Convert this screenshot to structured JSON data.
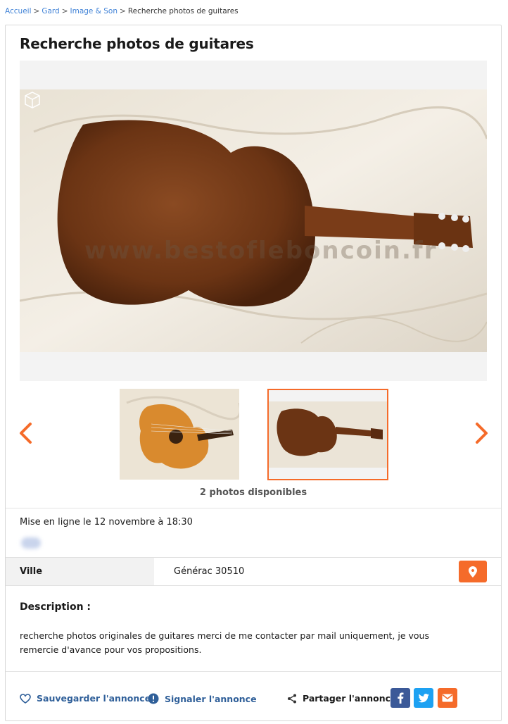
{
  "breadcrumb": {
    "home": "Accueil",
    "region": "Gard",
    "category": "Image & Son",
    "current": "Recherche photos de guitares",
    "separator": ">"
  },
  "ad": {
    "title": "Recherche photos de guitares",
    "photos_count_label": "2 photos disponibles",
    "published": "Mise en ligne le 12 novembre à 18:30",
    "watermark": "www.bestofleboncoin.fr",
    "city_label": "Ville",
    "city_value": "Générac 30510",
    "description_title": "Description :",
    "description_text": "recherche photos originales de guitares merci de me contacter par mail uniquement, je vous remercie d'avance pour vos propositions."
  },
  "actions": {
    "save": "Sauvegarder l'annonce",
    "report": "Signaler l'annonce",
    "share": "Partager l'annonce"
  },
  "colors": {
    "accent": "#f56b2a",
    "link": "#2f5f99",
    "facebook": "#3b5998",
    "twitter": "#1da1f2"
  },
  "icons": [
    "chevron-left-icon",
    "chevron-right-icon",
    "location-pin-icon",
    "heart-icon",
    "alert-icon",
    "share-icon",
    "facebook-icon",
    "twitter-icon",
    "mail-icon",
    "3d-cube-icon"
  ]
}
